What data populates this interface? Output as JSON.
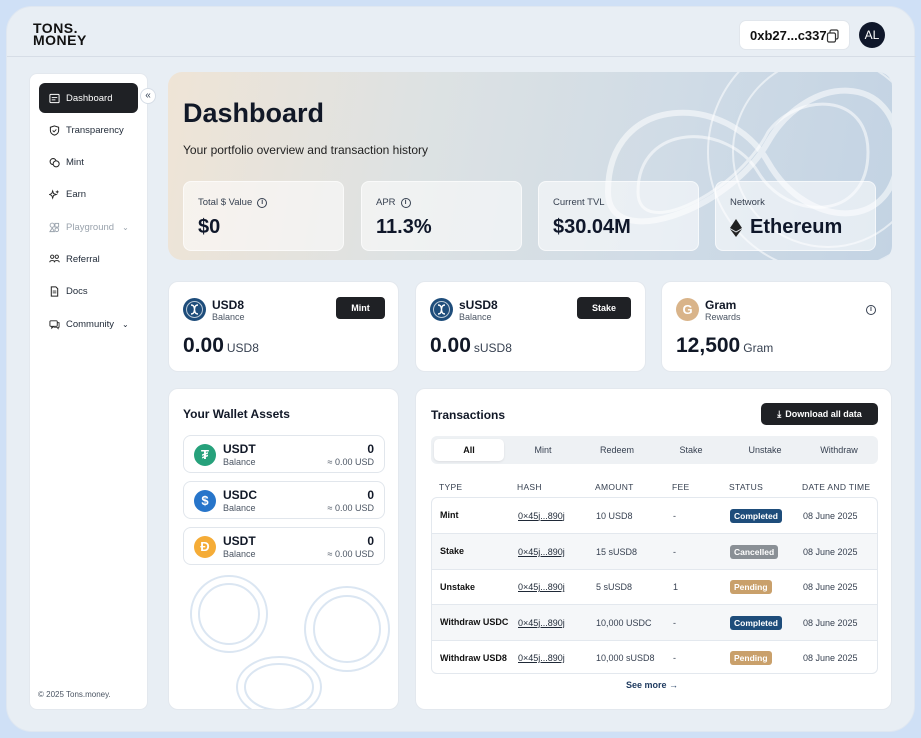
{
  "header": {
    "logo_line1": "TONS.",
    "logo_line2": "MONEY",
    "wallet_address": "0xb27...c337",
    "avatar_initials": "AL"
  },
  "sidebar": {
    "items": [
      {
        "label": "Dashboard",
        "icon": "dashboard-icon",
        "active": true
      },
      {
        "label": "Transparency",
        "icon": "shield-icon"
      },
      {
        "label": "Mint",
        "icon": "coins-icon"
      },
      {
        "label": "Earn",
        "icon": "sparkles-icon"
      },
      {
        "label": "Playground",
        "icon": "shapes-icon",
        "disabled": true
      },
      {
        "label": "Referral",
        "icon": "users-icon"
      },
      {
        "label": "Docs",
        "icon": "document-icon"
      },
      {
        "label": "Community",
        "icon": "chat-icon"
      }
    ],
    "copyright": "© 2025 Tons.money."
  },
  "hero": {
    "title": "Dashboard",
    "subtitle": "Your portfolio overview and transaction history",
    "stats": [
      {
        "label": "Total $ Value",
        "value": "$0"
      },
      {
        "label": "APR",
        "value": "11.3%"
      },
      {
        "label": "Current TVL",
        "value": "$30.04M"
      },
      {
        "label": "Network",
        "value": "Ethereum"
      }
    ]
  },
  "balances": [
    {
      "name": "USD8",
      "sub": "Balance",
      "amount": "0.00",
      "unit": "USD8",
      "button": "Mint"
    },
    {
      "name": "sUSD8",
      "sub": "Balance",
      "amount": "0.00",
      "unit": "sUSD8",
      "button": "Stake"
    },
    {
      "name": "Gram",
      "sub": "Rewards",
      "amount": "12,500",
      "unit": "Gram"
    }
  ],
  "wallet_assets": {
    "title": "Your Wallet Assets",
    "items": [
      {
        "name": "USDT",
        "sub": "Balance",
        "value": "0",
        "usd": "≈ 0.00 USD",
        "color": "#26a17b",
        "glyph": "₮"
      },
      {
        "name": "USDC",
        "sub": "Balance",
        "value": "0",
        "usd": "≈ 0.00 USD",
        "color": "#2775ca",
        "glyph": "$"
      },
      {
        "name": "USDT",
        "sub": "Balance",
        "value": "0",
        "usd": "≈ 0.00 USD",
        "color": "#f5ac37",
        "glyph": "Ð"
      }
    ]
  },
  "transactions": {
    "title": "Transactions",
    "download_label": "Download all data",
    "tabs": [
      "All",
      "Mint",
      "Redeem",
      "Stake",
      "Unstake",
      "Withdraw"
    ],
    "columns": [
      "TYPE",
      "HASH",
      "AMOUNT",
      "FEE",
      "STATUS",
      "DATE AND TIME"
    ],
    "rows": [
      {
        "type": "Mint",
        "hash": "0×45j...890j",
        "amount": "10 USD8",
        "fee": "-",
        "status": "Completed",
        "date": "08 June 2025"
      },
      {
        "type": "Stake",
        "hash": "0×45j...890j",
        "amount": "15 sUSD8",
        "fee": "-",
        "status": "Cancelled",
        "date": "08 June 2025"
      },
      {
        "type": "Unstake",
        "hash": "0×45j...890j",
        "amount": "5 sUSD8",
        "fee": "1",
        "status": "Pending",
        "date": "08 June 2025"
      },
      {
        "type": "Withdraw USDC",
        "hash": "0×45j...890j",
        "amount": "10,000 USDC",
        "fee": "-",
        "status": "Completed",
        "date": "08 June 2025"
      },
      {
        "type": "Withdraw USD8",
        "hash": "0×45j...890j",
        "amount": "10,000 sUSD8",
        "fee": "-",
        "status": "Pending",
        "date": "08 June 2025"
      }
    ],
    "status_colors": {
      "Completed": "#1e4d7b",
      "Cancelled": "#8a9096",
      "Pending": "#c9a06b"
    },
    "see_more": "See more"
  }
}
